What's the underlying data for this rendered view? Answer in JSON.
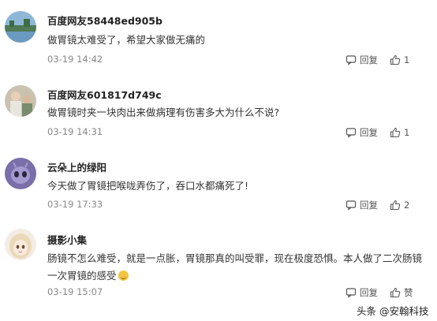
{
  "comments": [
    {
      "username": "百度网友58448ed905b",
      "content": "做胃镜太难受了，希望大家做无痛的",
      "time": "03-19 14:42",
      "reply_label": "回复",
      "like_label": "1",
      "avatar": "lake-landscape-avatar"
    },
    {
      "username": "百度网友601817d749c",
      "content": "做胃镜时夹一块肉出来做病理有伤害多大为什么不说?",
      "time": "03-19 14:31",
      "reply_label": "回复",
      "like_label": "1",
      "avatar": "people-photo-avatar"
    },
    {
      "username": "云朵上的绿阳",
      "content": "今天做了胃镜把喉咙弄伤了，吞口水都痛死了!",
      "time": "03-19 17:33",
      "reply_label": "回复",
      "like_label": "2",
      "avatar": "alien-avatar"
    },
    {
      "username": "摄影小集",
      "content": "肠镜不怎么难受，就是一点胀，胃镜那真的叫受罪，现在极度恐惧。本人做了二次肠镜一次胃镜的感受",
      "time": "03-19 15:07",
      "reply_label": "回复",
      "like_label": "赞",
      "avatar": "anime-girl-avatar"
    }
  ],
  "watermark": "头条 @安翰科技",
  "icons": {
    "reply": "speech-bubble-icon",
    "like": "thumbs-up-icon",
    "emoji": "smiley-emoji-icon"
  },
  "colors": {
    "meta_text": "#888888",
    "username_text": "#222222",
    "content_text": "#333333"
  }
}
